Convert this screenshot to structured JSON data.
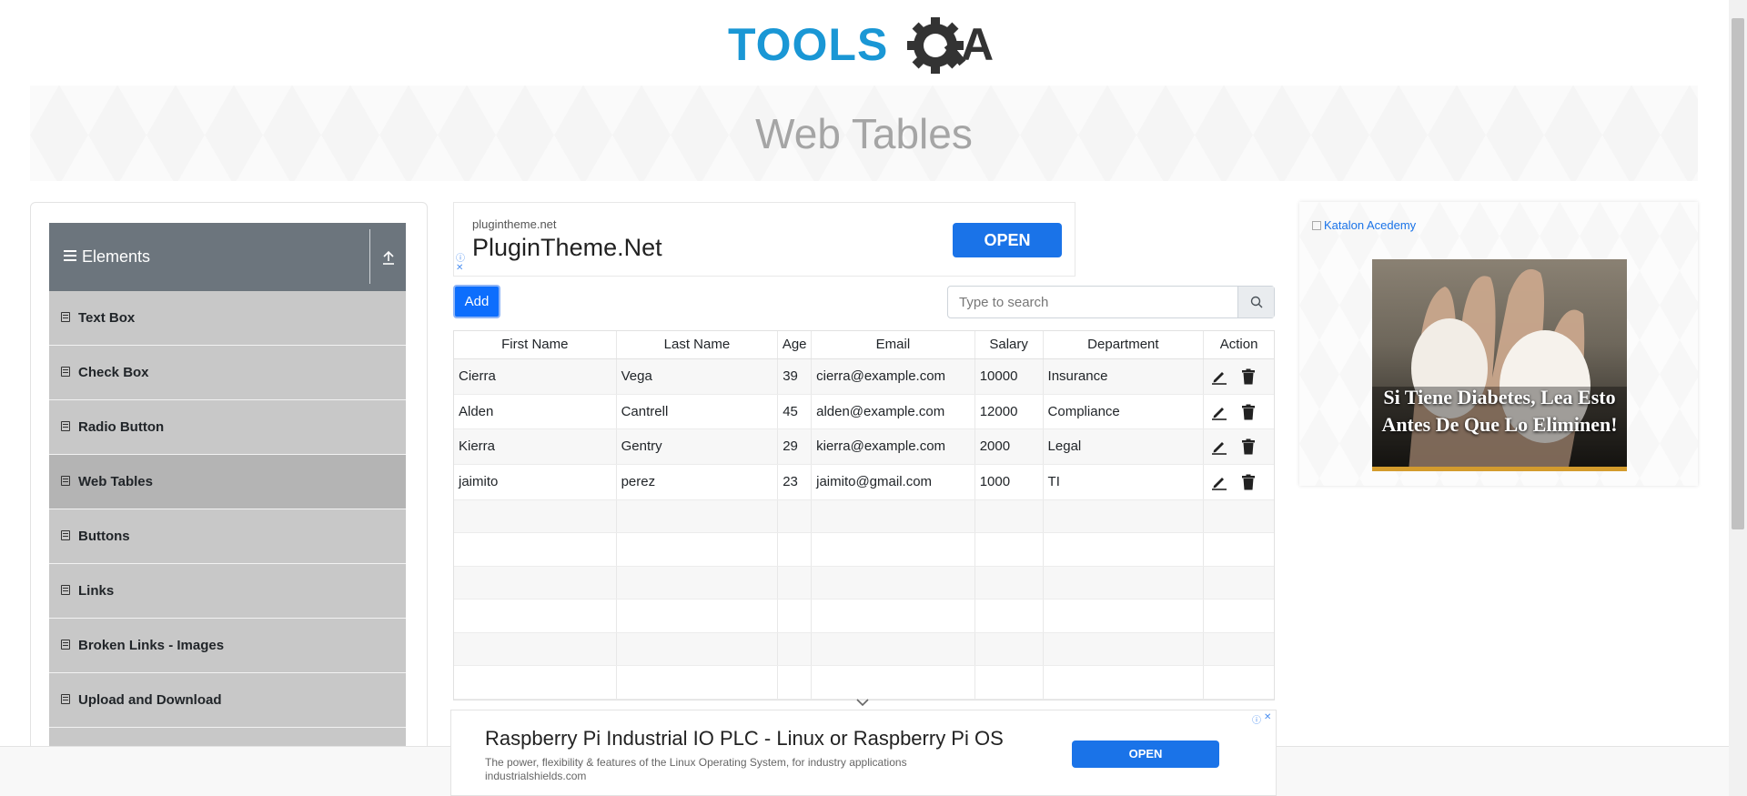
{
  "colors": {
    "accent": "#0d6efd",
    "logo_blue": "#1a97d5",
    "logo_dark": "#333333",
    "sidebar_header": "#6c757d",
    "menu_item": "#c8c8c8"
  },
  "logo": {
    "text_tools": "TOOLS",
    "text_qa": "QA"
  },
  "banner": {
    "title": "Web Tables"
  },
  "sidebar": {
    "group_title": "Elements",
    "group_icon": "hamburger-icon",
    "collapse_icon": "collapse-arrow-icon",
    "items": [
      {
        "label": "Text Box"
      },
      {
        "label": "Check Box"
      },
      {
        "label": "Radio Button"
      },
      {
        "label": "Web Tables",
        "active": true
      },
      {
        "label": "Buttons"
      },
      {
        "label": "Links"
      },
      {
        "label": "Broken Links - Images"
      },
      {
        "label": "Upload and Download"
      }
    ]
  },
  "ad_top": {
    "domain": "plugintheme.net",
    "name": "PluginTheme.Net",
    "cta": "OPEN"
  },
  "toolbar": {
    "add_label": "Add",
    "search_placeholder": "Type to search",
    "search_icon": "search-icon"
  },
  "table": {
    "headers": [
      "First Name",
      "Last Name",
      "Age",
      "Email",
      "Salary",
      "Department",
      "Action"
    ],
    "rows": [
      {
        "first": "Cierra",
        "last": "Vega",
        "age": "39",
        "email": "cierra@example.com",
        "salary": "10000",
        "dept": "Insurance"
      },
      {
        "first": "Alden",
        "last": "Cantrell",
        "age": "45",
        "email": "alden@example.com",
        "salary": "12000",
        "dept": "Compliance"
      },
      {
        "first": "Kierra",
        "last": "Gentry",
        "age": "29",
        "email": "kierra@example.com",
        "salary": "2000",
        "dept": "Legal"
      },
      {
        "first": "jaimito",
        "last": "perez",
        "age": "23",
        "email": "jaimito@gmail.com",
        "salary": "1000",
        "dept": "TI"
      }
    ],
    "action_icons": [
      "edit-pencil-icon",
      "delete-trash-icon"
    ]
  },
  "ad_bottom": {
    "headline": "Raspberry Pi Industrial IO PLC - Linux or Raspberry Pi OS",
    "description": "The power, flexibility & features of the Linux Operating System, for industry applications",
    "site": "industrialshields.com",
    "cta": "OPEN"
  },
  "ad_right": {
    "broken_image_alt": "Katalon Acedemy",
    "caption": "Si Tiene Diabetes, Lea Esto Antes De Que Lo Eliminen!"
  }
}
